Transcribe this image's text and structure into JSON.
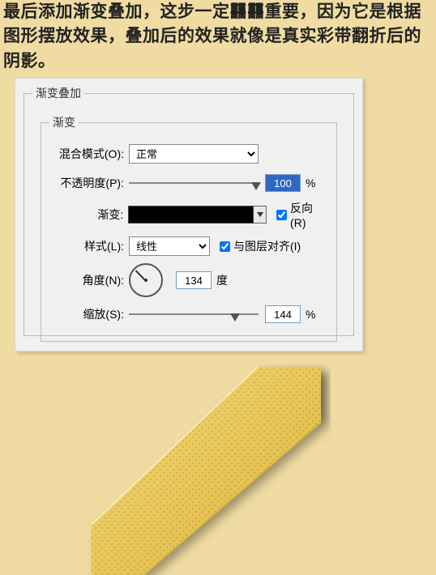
{
  "intro": {
    "line1": "最后添加渐变叠加，这步一定䨻䨻重要，因为它是根据图形摆放效果，叠加后的效果就像是真实彩带翻折后的阴影。"
  },
  "panel": {
    "outer_legend": "渐变叠加",
    "inner_legend": "渐变",
    "blend_mode": {
      "label": "混合模式(O):",
      "value": "正常"
    },
    "opacity": {
      "label": "不透明度(P):",
      "value": "100",
      "suffix": "%"
    },
    "gradient": {
      "label": "渐变:",
      "reverse_label": "反向(R)",
      "reverse_checked": true
    },
    "style": {
      "label": "样式(L):",
      "value": "线性",
      "align_label": "与图层对齐(I)",
      "align_checked": true
    },
    "angle": {
      "label": "角度(N):",
      "value": "134",
      "suffix": "度"
    },
    "scale": {
      "label": "缩放(S):",
      "value": "144",
      "suffix": "%"
    }
  }
}
